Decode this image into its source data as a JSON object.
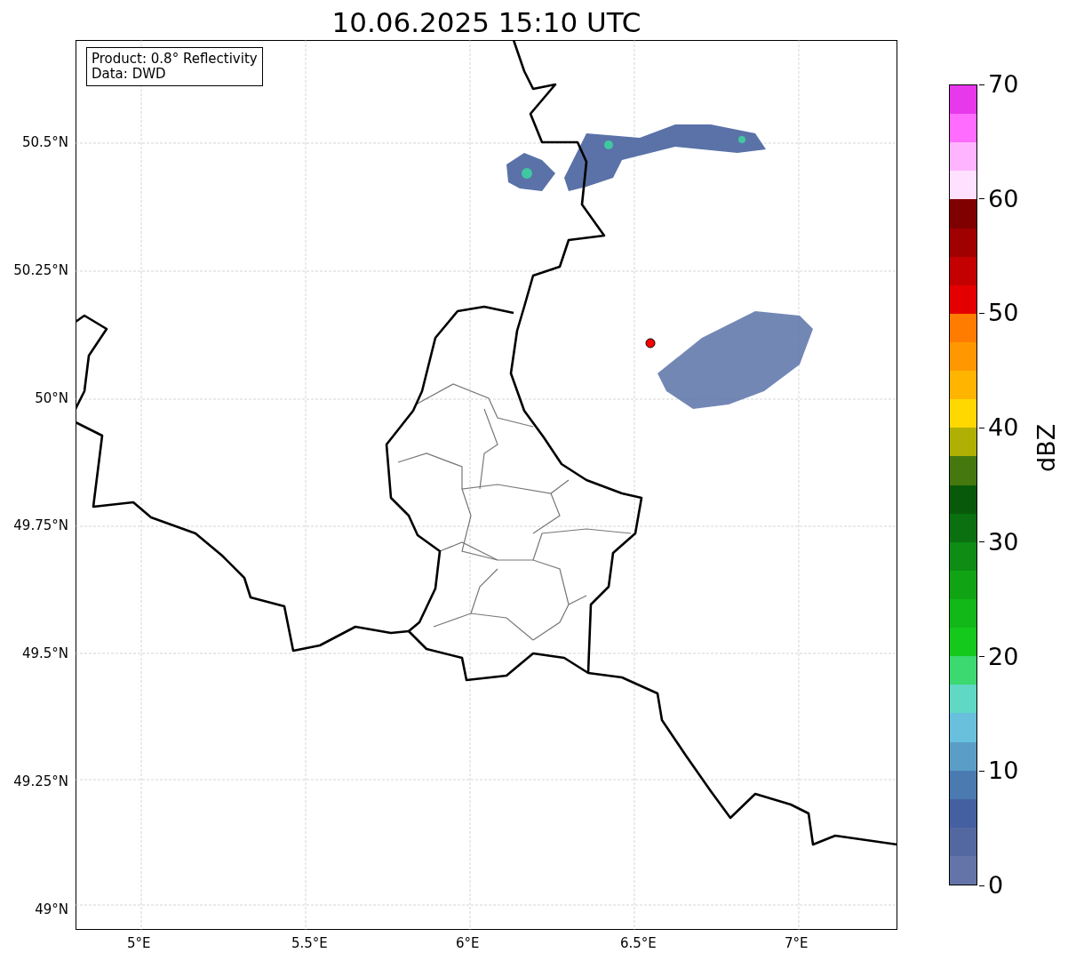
{
  "title": "10.06.2025 15:10 UTC",
  "map": {
    "info_box": [
      "Product: 0.8° Reflectivity",
      "Data: DWD"
    ],
    "yticks": [
      "50.5°N",
      "50.25°N",
      "50°N",
      "49.75°N",
      "49.5°N",
      "49.25°N",
      "49°N"
    ],
    "xticks": [
      "5°E",
      "5.5°E",
      "6°E",
      "6.5°E",
      "7°E"
    ]
  },
  "colorbar": {
    "label": "dBZ",
    "ticks": [
      "70",
      "60",
      "50",
      "40",
      "30",
      "20",
      "10",
      "0"
    ],
    "bins": [
      {
        "color": "#e838ec"
      },
      {
        "color": "#ff6cff"
      },
      {
        "color": "#ffb4ff"
      },
      {
        "color": "#ffe0ff"
      },
      {
        "color": "#800000"
      },
      {
        "color": "#a00000"
      },
      {
        "color": "#c40000"
      },
      {
        "color": "#e40000"
      },
      {
        "color": "#ff7c00"
      },
      {
        "color": "#ff9800"
      },
      {
        "color": "#ffb400"
      },
      {
        "color": "#ffd800"
      },
      {
        "color": "#b0b004"
      },
      {
        "color": "#467810"
      },
      {
        "color": "#085a0a"
      },
      {
        "color": "#0a7010"
      },
      {
        "color": "#0e8c14"
      },
      {
        "color": "#10a414"
      },
      {
        "color": "#12b818"
      },
      {
        "color": "#14c81c"
      },
      {
        "color": "#3cd870"
      },
      {
        "color": "#60d8c4"
      },
      {
        "color": "#68c0dc"
      },
      {
        "color": "#5a9ec6"
      },
      {
        "color": "#4a7ab0"
      },
      {
        "color": "#4460a0"
      },
      {
        "color": "#5468a0"
      },
      {
        "color": "#6474a8"
      }
    ]
  }
}
